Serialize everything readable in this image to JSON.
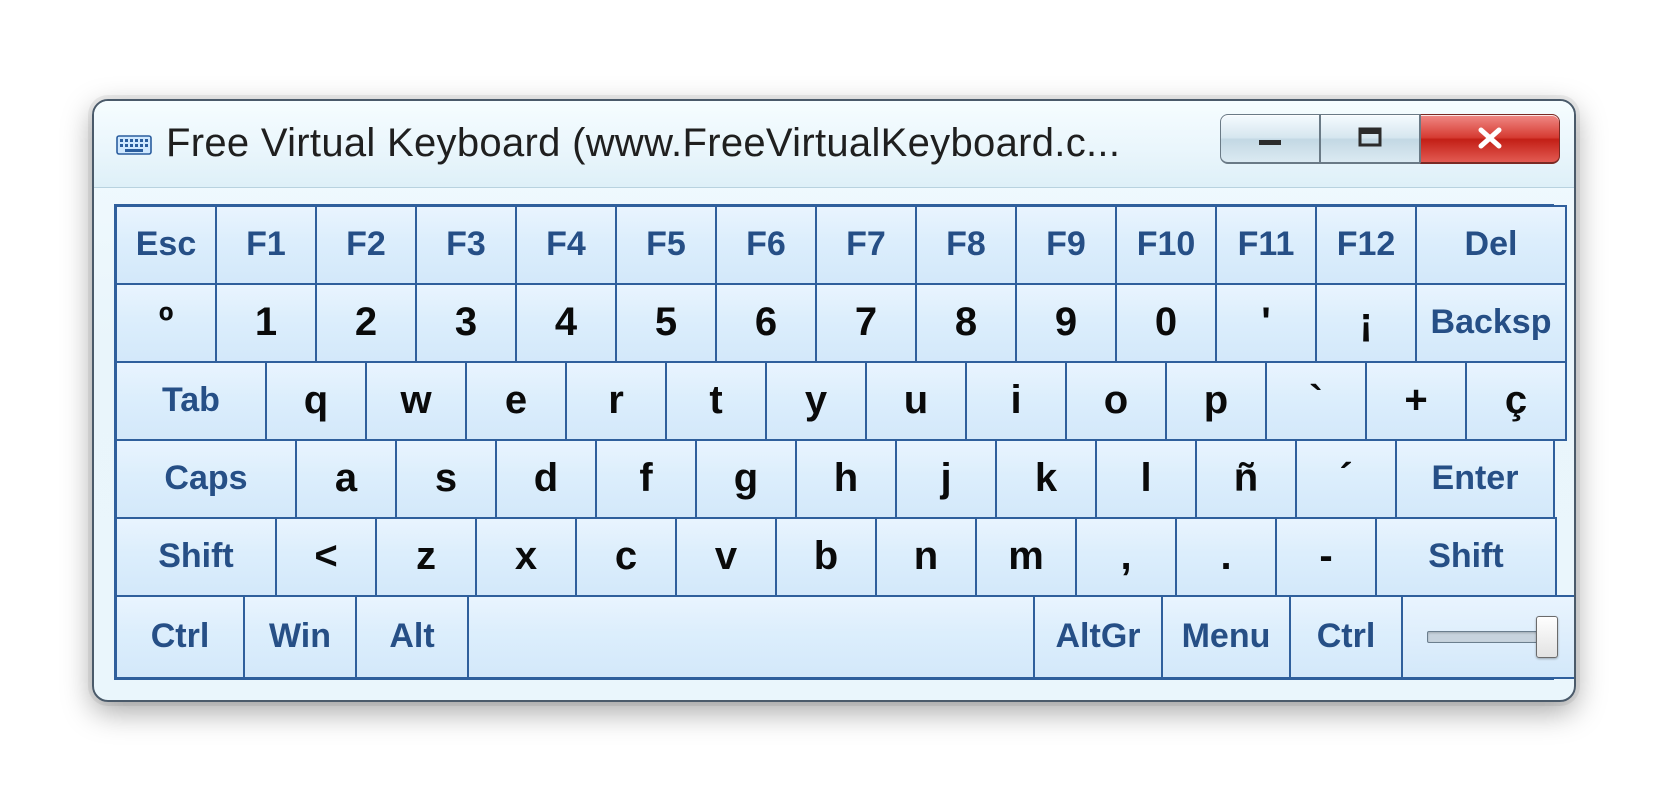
{
  "window": {
    "title": "Free Virtual Keyboard (www.FreeVirtualKeyboard.c..."
  },
  "keys": {
    "row0": [
      "Esc",
      "F1",
      "F2",
      "F3",
      "F4",
      "F5",
      "F6",
      "F7",
      "F8",
      "F9",
      "F10",
      "F11",
      "F12",
      "Del"
    ],
    "row1": [
      "º",
      "1",
      "2",
      "3",
      "4",
      "5",
      "6",
      "7",
      "8",
      "9",
      "0",
      "'",
      "¡",
      "Backsp"
    ],
    "row2": [
      "Tab",
      "q",
      "w",
      "e",
      "r",
      "t",
      "y",
      "u",
      "i",
      "o",
      "p",
      "`",
      "+",
      "ç"
    ],
    "row3": [
      "Caps",
      "a",
      "s",
      "d",
      "f",
      "g",
      "h",
      "j",
      "k",
      "l",
      "ñ",
      "´",
      "Enter"
    ],
    "row4": [
      "Shift",
      "<",
      "z",
      "x",
      "c",
      "v",
      "b",
      "n",
      "m",
      ",",
      ".",
      "-",
      "Shift"
    ],
    "row5": [
      "Ctrl",
      "Win",
      "Alt",
      "",
      "AltGr",
      "Menu",
      "Ctrl"
    ]
  }
}
